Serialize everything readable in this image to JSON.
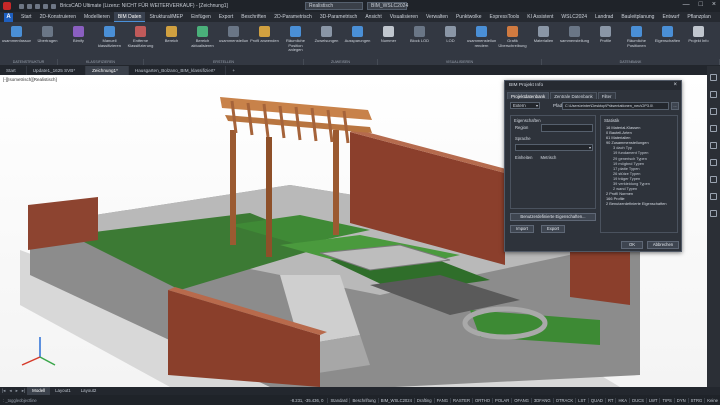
{
  "window": {
    "title": "BricsCAD Ultimate (Lizenz: NICHT FÜR WEITERVERKAUF) - [Zeichnung1]",
    "visual_style": "Realistisch",
    "workspace": "BIM_WSLC2024",
    "controls": [
      "—",
      "□",
      "×"
    ]
  },
  "menu": {
    "app_button": "A",
    "items": [
      "Start",
      "2D-Konstruieren",
      "Modellieren",
      "BIM Daten",
      "Struktural/MEP",
      "Einfügen",
      "Export",
      "Beschriften",
      "2D-Parametrisch",
      "3D-Parametrisch",
      "Ansicht",
      "Visualisieren",
      "Verwalten",
      "Punktwolke",
      "ExpressTools",
      "KI Assistent",
      "WSLC2024",
      "Landrad",
      "Bauleitplanung",
      "Entwurf",
      "Pflanzplan"
    ],
    "active_index": 3
  },
  "ribbon": {
    "buttons": [
      {
        "label": "Zusammenfassung",
        "icon": "summary-icon",
        "color": "#4a8fd6"
      },
      {
        "label": "Übertragen",
        "icon": "transfer-icon",
        "color": "#6a7686"
      },
      {
        "label": "Bimify",
        "icon": "bimify-icon",
        "color": "#8a5fc0"
      },
      {
        "label": "Manuell klassifizieren",
        "icon": "classify-manual-icon",
        "color": "#4a8fd6"
      },
      {
        "label": "Entferne Klassifizierung",
        "icon": "remove-classification-icon",
        "color": "#c05a5a"
      },
      {
        "label": "Bereich",
        "icon": "area-icon",
        "color": "#d0a040"
      },
      {
        "label": "Bereich aktualisieren",
        "icon": "area-refresh-icon",
        "color": "#4ab07a"
      },
      {
        "label": "Zusammenstellung",
        "icon": "assembly-icon",
        "color": "#6a7686"
      },
      {
        "label": "Profil anwenden",
        "icon": "profile-apply-icon",
        "color": "#d0a040"
      },
      {
        "label": "Räumliche Position anlegen",
        "icon": "spatial-position-icon",
        "color": "#4a8fd6"
      },
      {
        "label": "Zuweisungen",
        "icon": "assignments-icon",
        "color": "#8a96a6"
      },
      {
        "label": "Aussparungen",
        "icon": "openings-icon",
        "color": "#4a8fd6"
      },
      {
        "label": "Nummer",
        "icon": "number-icon",
        "color": "#c0c6ce"
      },
      {
        "label": "Block LOD",
        "icon": "block-lod-icon",
        "color": "#6a7686"
      },
      {
        "label": "LOD",
        "icon": "lod-icon",
        "color": "#8a96a6"
      },
      {
        "label": "Zusammenstellung rendern",
        "icon": "render-assembly-icon",
        "color": "#4a8fd6"
      },
      {
        "label": "Grafik Überschreibung",
        "icon": "graphic-override-icon",
        "color": "#d07a40"
      },
      {
        "label": "Materialien",
        "icon": "materials-icon",
        "color": "#8a96a6"
      },
      {
        "label": "Zusammenstellungen",
        "icon": "assemblies-icon",
        "color": "#6a7686"
      },
      {
        "label": "Profile",
        "icon": "profiles-icon",
        "color": "#8a96a6"
      },
      {
        "label": "Räumliche Positionen",
        "icon": "spatial-positions-icon",
        "color": "#4a8fd6"
      },
      {
        "label": "Eigenschaften",
        "icon": "properties-icon",
        "color": "#4a8fd6"
      },
      {
        "label": "Projekt Info",
        "icon": "project-info-icon",
        "color": "#c0c6ce"
      }
    ],
    "groups": [
      "DATENSTRUKTUR",
      "KLASSIFIZIEREN",
      "ERSTELLEN",
      "ZUWEISEN",
      "VISUALISIEREN",
      "DATENBANK"
    ]
  },
  "doc_tabs": {
    "items": [
      "Start",
      "Update1_1625 SVB*",
      "Zeichnung1*",
      "Hausgarten_Bolzano_BIM_klassifiziert*"
    ],
    "active_index": 2,
    "plus": "+"
  },
  "viewport": {
    "label": "[-][Isometrisch][Realistisch]"
  },
  "dialog": {
    "title": "BIM Projekt Info",
    "close": "×",
    "tabs": [
      "Projektdatenbank",
      "Zentrale Datenbank",
      "Filter"
    ],
    "active_tab": 0,
    "mode_value": "Extern",
    "pfad_label": "Pfad:",
    "pfad_value": "C:\\Users\\einter\\Desktop\\Präsentationen_neu\\OP3.0\\",
    "browse": "...",
    "left_section_title": "Eigenschaften",
    "region_label": "Region",
    "language_label": "Sprache",
    "units_label": "Einheiten",
    "units_value": "Metrisch",
    "custom_props_button": "Benutzerdefinierte Eigenschaften...",
    "import_button": "Import",
    "export_button": "Export",
    "statistics_title": "Statistik",
    "statistics": [
      {
        "text": "16 Material-Klassen",
        "level": 1
      },
      {
        "text": "0 Bauteil-Arten",
        "level": 1
      },
      {
        "text": "61 Materialien",
        "level": 1
      },
      {
        "text": "90 Zusammenstellungen",
        "level": 1
      },
      {
        "text": "3 dach Typ",
        "level": 2
      },
      {
        "text": "19 fundament Typen",
        "level": 2
      },
      {
        "text": "29 generisch Typen",
        "level": 2
      },
      {
        "text": "19 mögbnd Typen",
        "level": 2
      },
      {
        "text": "17 platte Typen",
        "level": 2
      },
      {
        "text": "26 stütze Typen",
        "level": 2
      },
      {
        "text": "19 träger Typen",
        "level": 2
      },
      {
        "text": "39 verkleidung Typen",
        "level": 2
      },
      {
        "text": "2 wand Typen",
        "level": 2
      },
      {
        "text": "2 Profil Normen",
        "level": 1
      },
      {
        "text": "166 Profile",
        "level": 1
      },
      {
        "text": "2 Benutzerdefinierte Eigenschaften",
        "level": 1
      }
    ],
    "ok_button": "OK",
    "cancel_button": "Abbrechen"
  },
  "layout_tabs": {
    "items": [
      "Modell",
      "Layout1",
      "Layout2"
    ],
    "active_index": 0
  },
  "status": {
    "command": ": _toggleobjectline",
    "coords": "-8.231, -35.436, 0",
    "items": [
      "Standard",
      "Beschriftung",
      "BIM_WSLC2024",
      "Drafting",
      "FANG",
      "RASTER",
      "ORTHO",
      "POLAR",
      "OFANG",
      "3DFANG",
      "OTRACK",
      "LST",
      "QUAD",
      "RT",
      "HKA",
      "DUCS",
      "LWT",
      "TIPS",
      "DYN",
      "STRG",
      "Keine"
    ]
  },
  "colors": {
    "accent": "#4a90d9",
    "ribbon_bg": "#333842",
    "dialog_bg": "#2e333b"
  }
}
